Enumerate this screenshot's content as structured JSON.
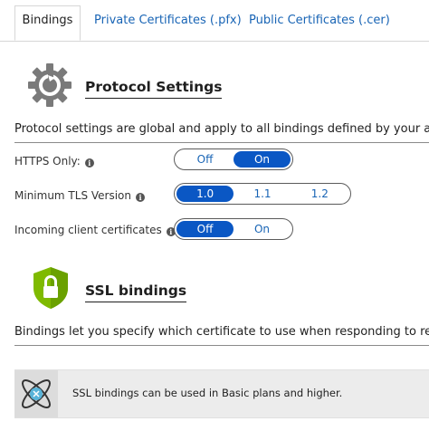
{
  "tabs": [
    {
      "label": "Bindings",
      "active": true
    },
    {
      "label": "Private Certificates (.pfx)",
      "active": false
    },
    {
      "label": "Public Certificates (.cer)",
      "active": false
    }
  ],
  "protocol": {
    "title": "Protocol Settings",
    "icon": "gear-icon",
    "description": "Protocol settings are global and apply to all bindings defined by your app.",
    "https_only": {
      "label": "HTTPS Only:",
      "options": [
        "Off",
        "On"
      ],
      "selected": "On"
    },
    "min_tls": {
      "label": "Minimum TLS Version",
      "options": [
        "1.0",
        "1.1",
        "1.2"
      ],
      "selected": "1.0"
    },
    "client_certs": {
      "label": "Incoming client certificates",
      "options": [
        "Off",
        "On"
      ],
      "selected": "Off"
    }
  },
  "ssl": {
    "title": "SSL bindings",
    "icon": "shield-lock-icon",
    "description": "Bindings let you specify which certificate to use when responding to requests"
  },
  "infobar": {
    "icon": "atom-icon",
    "text": "SSL bindings can be used in Basic plans and higher."
  },
  "colors": {
    "accent": "#0a57c4",
    "link": "#1864b5",
    "shield": "#7fba00"
  }
}
